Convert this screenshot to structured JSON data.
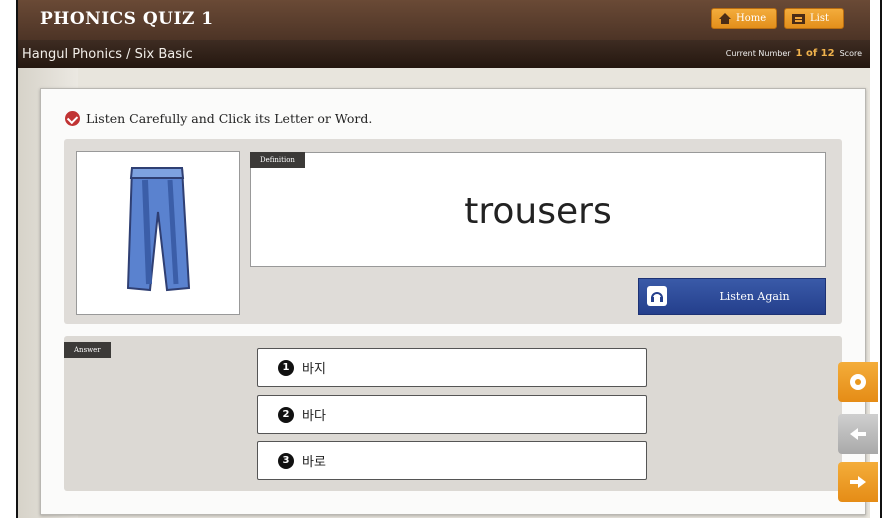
{
  "header": {
    "title": "PHONICS QUIZ 1",
    "home_label": "Home",
    "list_label": "List"
  },
  "subheader": {
    "path": "Hangul Phonics / Six Basic",
    "current_number_label": "Current Number",
    "current_number": "1 of 12",
    "score_label": "Score"
  },
  "instruction": "Listen Carefully and Click its Letter or Word.",
  "definition": {
    "tag": "Definition",
    "word": "trousers"
  },
  "listen_again_label": "Listen Again",
  "answer_tag": "Answer",
  "choices": [
    {
      "num": "1",
      "text": "바지"
    },
    {
      "num": "2",
      "text": "바다"
    },
    {
      "num": "3",
      "text": "바로"
    }
  ],
  "colors": {
    "accent_orange": "#e98f1b",
    "listen_blue": "#2b4a98",
    "top_brown": "#5a3d2d",
    "check_red": "#c13434"
  },
  "icons": [
    "home-icon",
    "list-icon",
    "check-icon",
    "headphone-icon",
    "gear-icon",
    "arrow-left-icon",
    "arrow-right-icon"
  ]
}
